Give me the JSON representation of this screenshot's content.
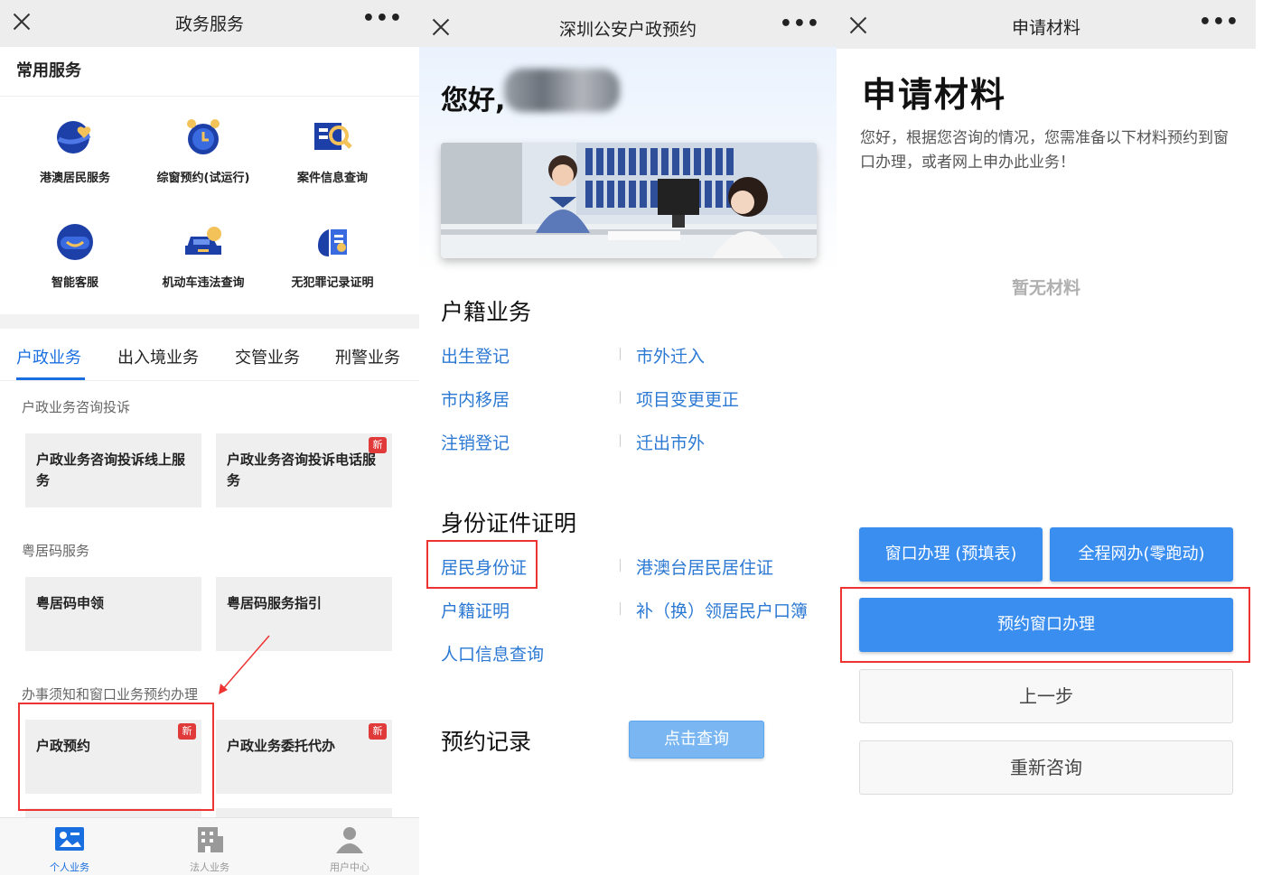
{
  "screen1": {
    "title": "政务服务",
    "more": "•••",
    "section_title": "常用服务",
    "services": [
      {
        "label": "港澳居民服务",
        "icon": "globe-heart-icon"
      },
      {
        "label": "综窗预约(试运行)",
        "icon": "alarm-clock-icon"
      },
      {
        "label": "案件信息查询",
        "icon": "search-document-icon"
      },
      {
        "label": "智能客服",
        "icon": "robot-smile-icon"
      },
      {
        "label": "机动车违法查询",
        "icon": "car-icon"
      },
      {
        "label": "无犯罪记录证明",
        "icon": "hand-document-icon"
      }
    ],
    "tabs": [
      "户政业务",
      "出入境业务",
      "交管业务",
      "刑警业务"
    ],
    "groups": [
      {
        "title": "户政业务咨询投诉",
        "cards": [
          {
            "label": "户政业务咨询投诉线上服务",
            "badge": ""
          },
          {
            "label": "户政业务咨询投诉电话服务",
            "badge": "新"
          }
        ]
      },
      {
        "title": "粤居码服务",
        "cards": [
          {
            "label": "粤居码申领",
            "badge": ""
          },
          {
            "label": "粤居码服务指引",
            "badge": ""
          }
        ]
      },
      {
        "title": "办事须知和窗口业务预约办理",
        "cards": [
          {
            "label": "户政预约",
            "badge": "新"
          },
          {
            "label": "户政业务委托代办",
            "badge": "新"
          }
        ]
      }
    ],
    "bottom_nav": [
      {
        "label": "个人业务",
        "icon": "personal-card-icon",
        "active": "true"
      },
      {
        "label": "法人业务",
        "icon": "building-icon",
        "active": "false"
      },
      {
        "label": "用户中心",
        "icon": "user-icon",
        "active": "false"
      }
    ]
  },
  "screen2": {
    "title": "深圳公安户政预约",
    "more": "•••",
    "greeting": "您好,",
    "sections": [
      {
        "title": "户籍业务",
        "links": [
          "出生登记",
          "市外迁入",
          "市内移居",
          "项目变更更正",
          "注销登记",
          "迁出市外"
        ]
      },
      {
        "title": "身份证件证明",
        "links": [
          "居民身份证",
          "港澳台居民居住证",
          "户籍证明",
          "补（换）领居民户口簿",
          "人口信息查询"
        ]
      }
    ],
    "record_title": "预约记录",
    "query_button": "点击查询"
  },
  "screen3": {
    "title": "申请材料",
    "more": "•••",
    "heading": "申请材料",
    "description": "您好，根据您咨询的情况，您需准备以下材料预约到窗口办理，或者网上申办此业务！",
    "empty_text": "暂无材料",
    "btn_window": "窗口办理 (预填表)",
    "btn_online": "全程网办(零跑动)",
    "btn_reserve": "预约窗口办理",
    "btn_prev": "上一步",
    "btn_reconsult": "重新咨询"
  },
  "colors": {
    "accent_blue": "#1a6fe0",
    "link_blue": "#2c79d3",
    "button_blue": "#3a8ef0",
    "highlight_red": "#e33333",
    "badge_red": "#e03a3a"
  }
}
